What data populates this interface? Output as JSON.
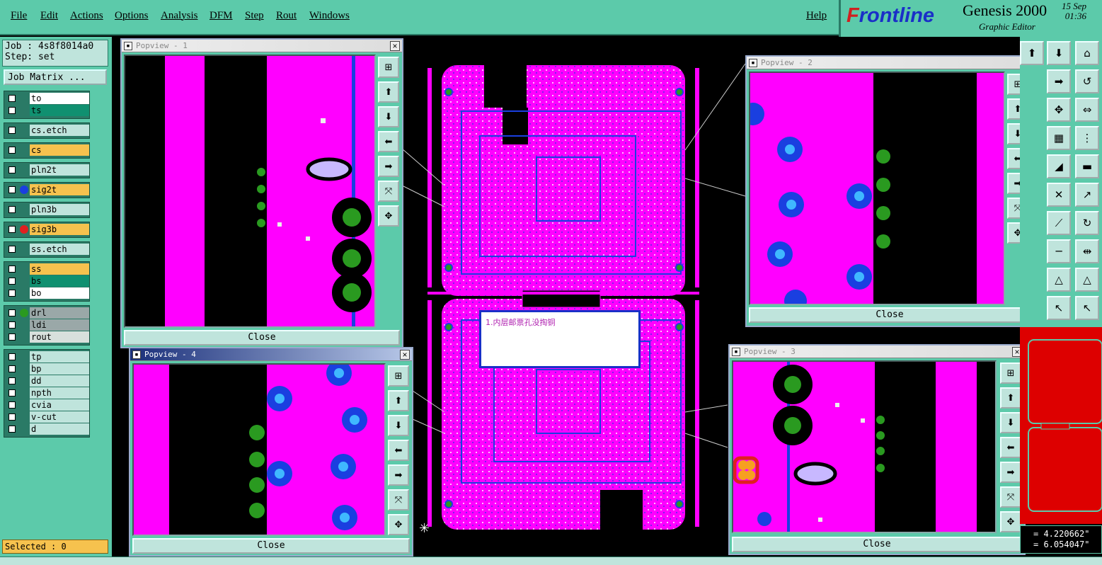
{
  "menu": [
    "File",
    "Edit",
    "Actions",
    "Options",
    "Analysis",
    "DFM",
    "Step",
    "Rout",
    "Windows"
  ],
  "help": "Help",
  "brand": {
    "name_first": "F",
    "name_rest": "rontline",
    "product": "Genesis 2000",
    "subtitle": "Graphic Editor",
    "date": "15 Sep",
    "time": "01:36"
  },
  "job": {
    "job_label": "Job : 4s8f8014a0",
    "step_label": "Step: set",
    "matrix_button": "Job Matrix ..."
  },
  "layer_groups": [
    [
      {
        "name": "to",
        "color": "#ffffff",
        "dot": ""
      },
      {
        "name": "ts",
        "color": "#109070",
        "dot": ""
      }
    ],
    [
      {
        "name": "cs.etch",
        "color": "#bfe4dc",
        "dot": ""
      }
    ],
    [
      {
        "name": "cs",
        "color": "#f6c24e",
        "dot": ""
      }
    ],
    [
      {
        "name": "pln2t",
        "color": "#bfe4dc",
        "dot": ""
      }
    ],
    [
      {
        "name": "sig2t",
        "color": "#f6c24e",
        "dot": "#1a3fe0"
      }
    ],
    [
      {
        "name": "pln3b",
        "color": "#bfe4dc",
        "dot": ""
      }
    ],
    [
      {
        "name": "sig3b",
        "color": "#f6c24e",
        "dot": "#e02020"
      }
    ],
    [
      {
        "name": "ss.etch",
        "color": "#bfe4dc",
        "dot": ""
      }
    ],
    [
      {
        "name": "ss",
        "color": "#f6c24e",
        "dot": ""
      },
      {
        "name": "bs",
        "color": "#109070",
        "dot": ""
      },
      {
        "name": "bo",
        "color": "#ffffff",
        "dot": ""
      }
    ],
    [
      {
        "name": "drl",
        "color": "#9aa8a8",
        "dot": "#2a9a20"
      },
      {
        "name": "ldi",
        "color": "#9aa8a8",
        "dot": ""
      },
      {
        "name": "rout",
        "color": "#d8e0dc",
        "dot": ""
      }
    ],
    [
      {
        "name": "tp",
        "color": "#bfe4dc",
        "dot": ""
      },
      {
        "name": "bp",
        "color": "#bfe4dc",
        "dot": ""
      },
      {
        "name": "dd",
        "color": "#bfe4dc",
        "dot": ""
      },
      {
        "name": "npth",
        "color": "#bfe4dc",
        "dot": ""
      },
      {
        "name": "cvia",
        "color": "#bfe4dc",
        "dot": ""
      },
      {
        "name": "v-cut",
        "color": "#bfe4dc",
        "dot": ""
      },
      {
        "name": "d",
        "color": "#bfe4dc",
        "dot": ""
      }
    ]
  ],
  "selected_label": "Selected : 0",
  "popviews": {
    "p1": {
      "title": "Popview - 1",
      "close": "Close"
    },
    "p2": {
      "title": "Popview - 2",
      "close": "Close"
    },
    "p3": {
      "title": "Popview - 3",
      "close": "Close"
    },
    "p4": {
      "title": "Popview - 4",
      "close": "Close"
    }
  },
  "message": "1.内层邮票孔没掏铜",
  "coords": {
    "x": "= 4.220662\"",
    "y": "= 6.054047\""
  },
  "colors": {
    "panel": "#5ccaaa",
    "board": "#ff00ff",
    "pad_blue": "#1a3fe0",
    "pad_green": "#2a9a20"
  }
}
